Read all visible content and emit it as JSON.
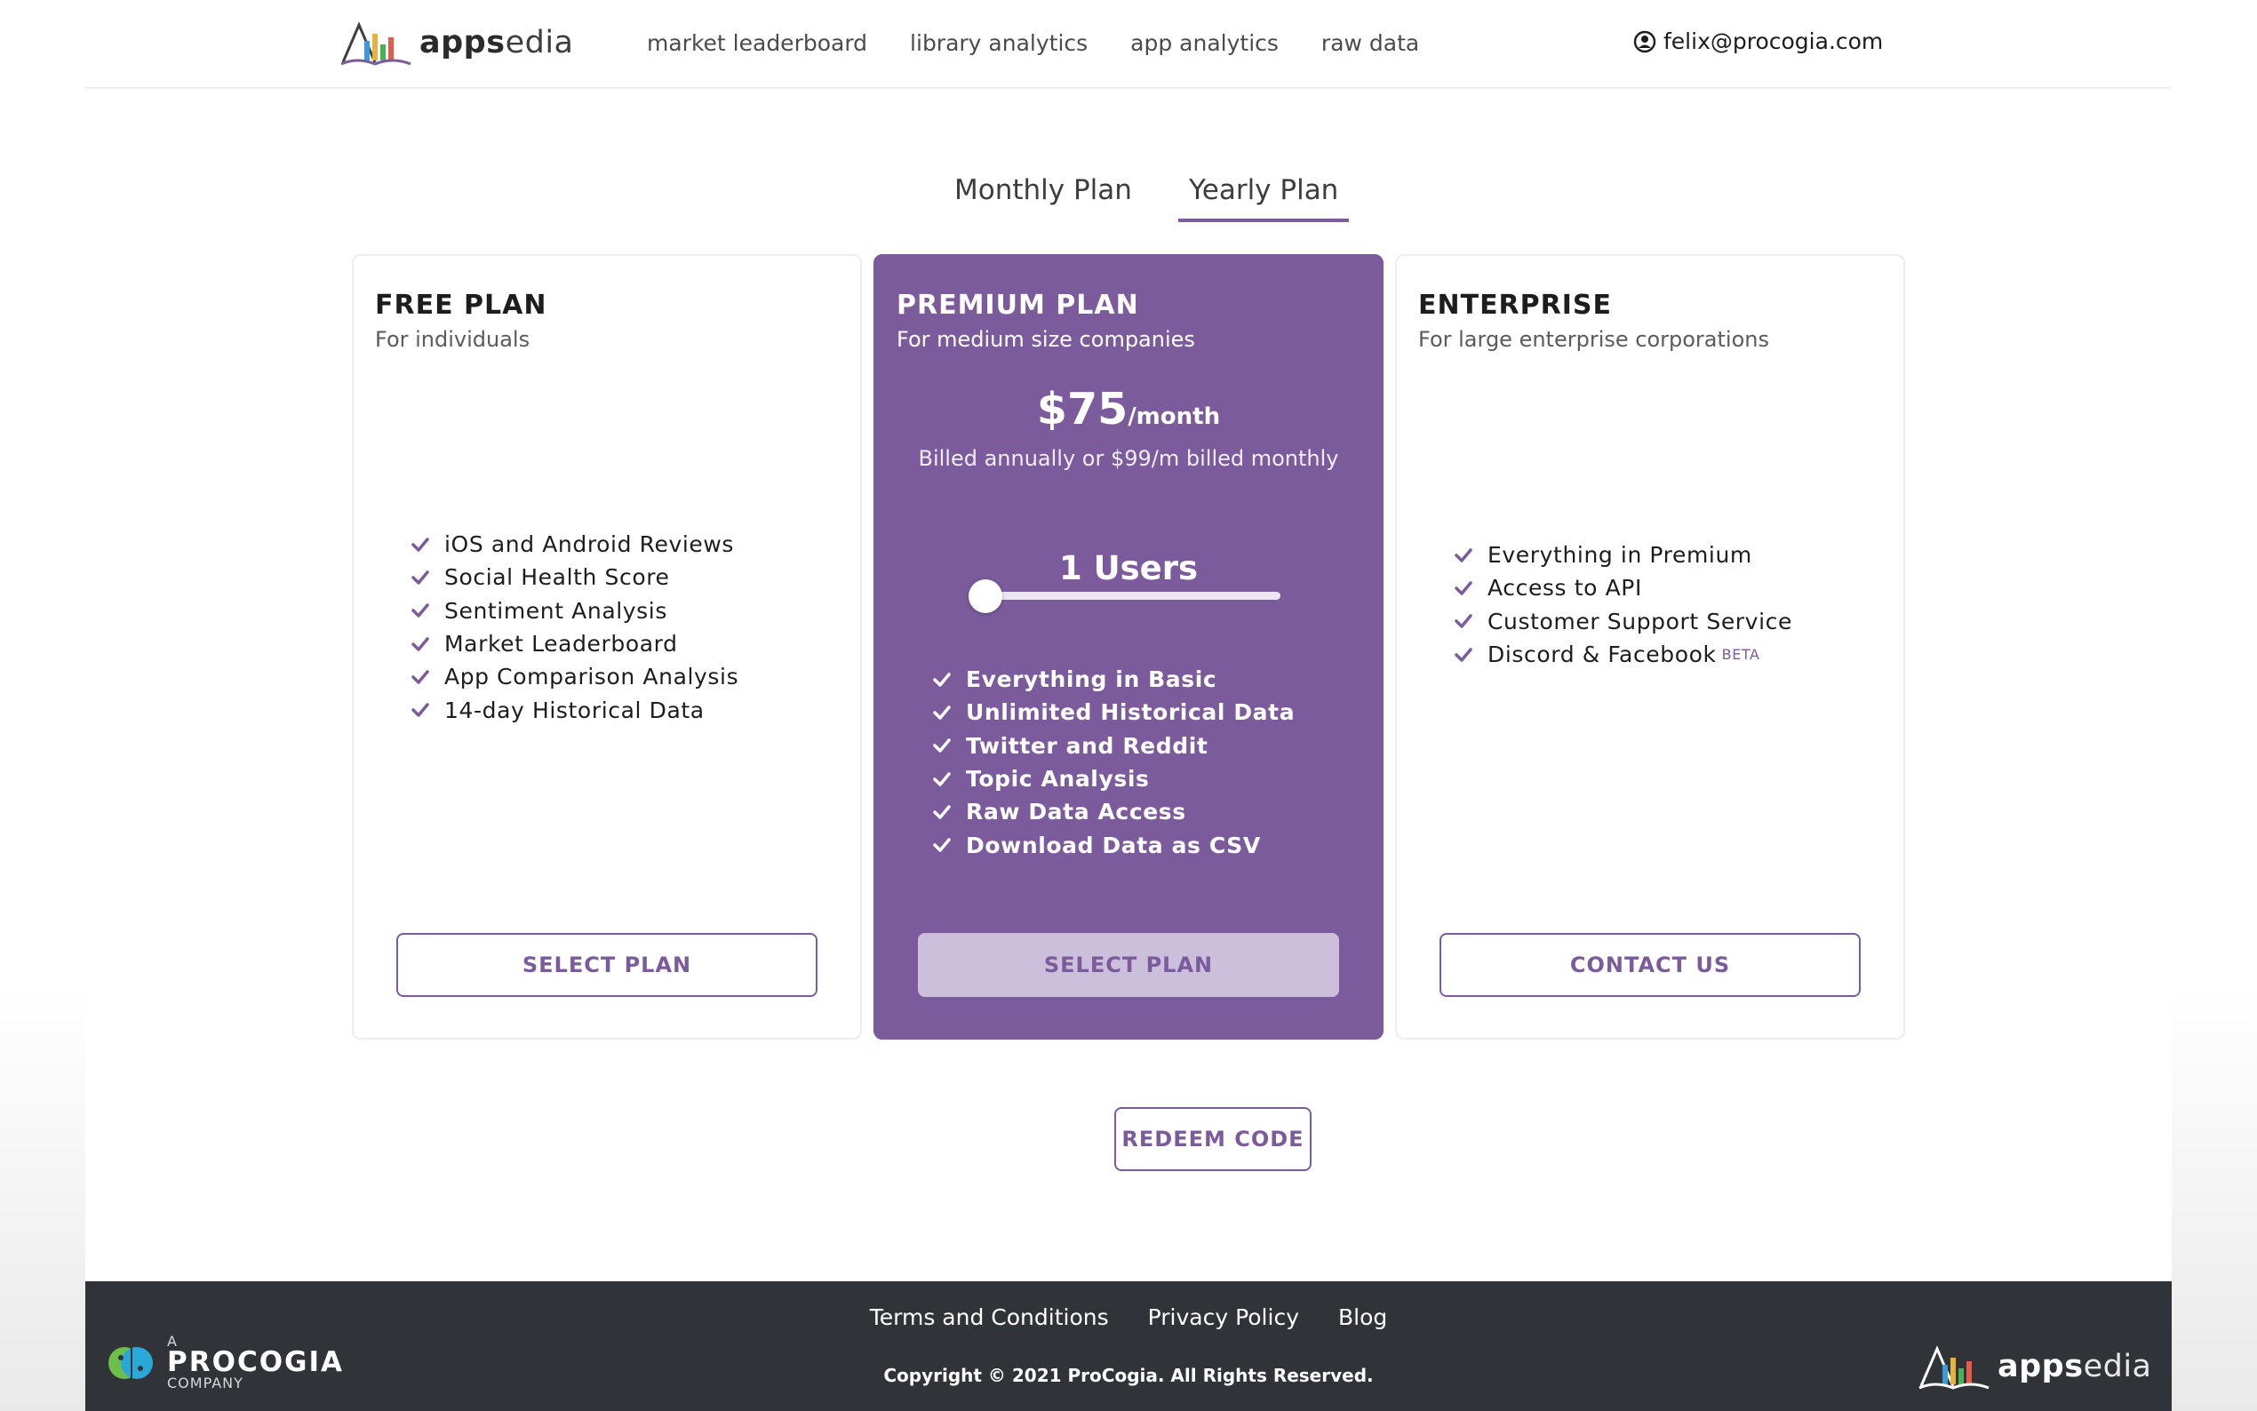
{
  "brand": {
    "logo_apps": "apps",
    "logo_edia": "edia"
  },
  "nav": {
    "items": [
      {
        "label": "market leaderboard"
      },
      {
        "label": "library analytics"
      },
      {
        "label": "app analytics"
      },
      {
        "label": "raw data"
      }
    ]
  },
  "user": {
    "email": "felix@procogia.com",
    "icon": "user-circle-icon"
  },
  "tabs": [
    {
      "label": "Monthly Plan",
      "active": false
    },
    {
      "label": "Yearly Plan",
      "active": true
    }
  ],
  "colors": {
    "accent": "#7b5b9b",
    "footer": "#303338"
  },
  "plans": {
    "free": {
      "title": "FREE PLAN",
      "subtitle": "For individuals",
      "features": [
        "iOS and Android Reviews",
        "Social Health Score",
        "Sentiment Analysis",
        "Market Leaderboard",
        "App Comparison Analysis",
        "14-day Historical Data"
      ],
      "button": "SELECT PLAN"
    },
    "premium": {
      "title": "PREMIUM PLAN",
      "subtitle": "For medium size companies",
      "price": "$75",
      "price_unit": "/month",
      "billing": "Billed annually or $99/m billed monthly",
      "users_label": "1 Users",
      "users_slider_fraction": 0.0,
      "features": [
        "Everything in Basic",
        "Unlimited Historical Data",
        "Twitter and Reddit",
        "Topic Analysis",
        "Raw Data Access",
        "Download Data as CSV"
      ],
      "button": "SELECT PLAN"
    },
    "enterprise": {
      "title": "ENTERPRISE",
      "subtitle": "For large enterprise corporations",
      "features": [
        "Everything in Premium",
        "Access to API",
        "Customer Support Service",
        "Discord & Facebook"
      ],
      "beta_label": "BETA",
      "button": "CONTACT US"
    }
  },
  "redeem": {
    "label": "REDEEM CODE"
  },
  "footer": {
    "links": [
      "Terms and Conditions",
      "Privacy Policy",
      "Blog"
    ],
    "copyright": "Copyright © 2021 ProCogia. All Rights Reserved.",
    "procogia_a": "A",
    "procogia_name": "PROCOGIA",
    "procogia_company": "COMPANY"
  }
}
